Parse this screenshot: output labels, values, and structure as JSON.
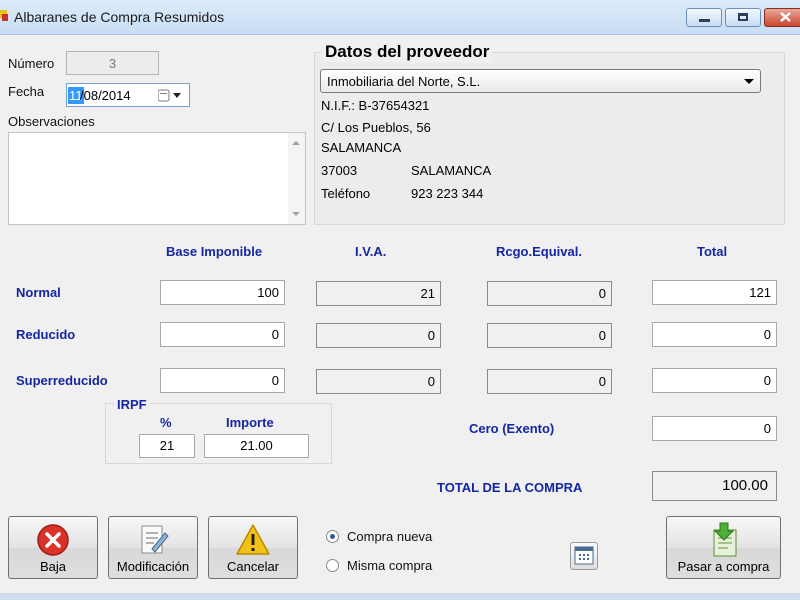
{
  "window": {
    "title": "Albaranes de Compra Resumidos"
  },
  "form": {
    "numero_label": "Número",
    "numero_value": "3",
    "fecha_label": "Fecha",
    "fecha_day": "11",
    "fecha_rest": "/08/2014",
    "observaciones_label": "Observaciones",
    "observaciones_value": ""
  },
  "proveedor": {
    "title": "Datos del proveedor",
    "selected": "Inmobiliaria del Norte, S.L.",
    "nif": "N.I.F.: B-37654321",
    "address": "C/ Los Pueblos, 56",
    "city": "SALAMANCA",
    "postal_code": "37003",
    "province": "SALAMANCA",
    "phone_label": "Teléfono",
    "phone": "923 223 344"
  },
  "grid": {
    "headers": {
      "base": "Base Imponible",
      "iva": "I.V.A.",
      "rcgo": "Rcgo.Equival.",
      "total": "Total"
    },
    "rows": [
      {
        "label": "Normal",
        "base": "100",
        "iva": "21",
        "rcgo": "0",
        "total": "121"
      },
      {
        "label": "Reducido",
        "base": "0",
        "iva": "0",
        "rcgo": "0",
        "total": "0"
      },
      {
        "label": "Superreducido",
        "base": "0",
        "iva": "0",
        "rcgo": "0",
        "total": "0"
      }
    ],
    "cero_label": "Cero (Exento)",
    "cero_value": "0"
  },
  "irpf": {
    "title": "IRPF",
    "pct_label": "%",
    "pct_value": "21",
    "importe_label": "Importe",
    "importe_value": "21.00"
  },
  "total": {
    "label": "TOTAL DE LA COMPRA",
    "value": "100.00"
  },
  "buttons": {
    "baja": "Baja",
    "modificacion": "Modificación",
    "cancelar": "Cancelar",
    "pasar": "Pasar a compra"
  },
  "options": {
    "nueva": "Compra nueva",
    "misma": "Misma compra",
    "selected": "Compra nueva"
  },
  "icons": {
    "baja": "delete-icon",
    "modificacion": "edit-document-icon",
    "cancelar": "warning-icon",
    "pasar": "download-document-icon",
    "calendar": "calendar-icon"
  },
  "colors": {
    "label_blue": "#1526a3",
    "titlebar": "#c9def4",
    "selection": "#3399ff"
  }
}
